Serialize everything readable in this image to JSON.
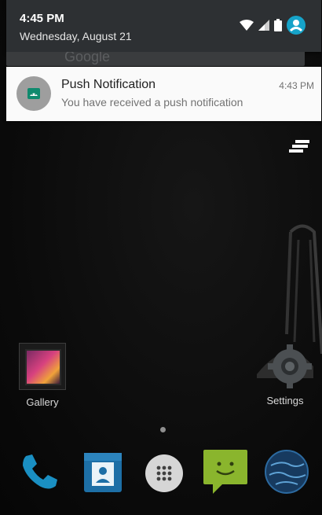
{
  "status": {
    "time": "4:45 PM",
    "date": "Wednesday, August 21",
    "icons": [
      "wifi-icon",
      "signal-icon",
      "battery-icon",
      "user-avatar-icon"
    ],
    "accent": "#16a3c9"
  },
  "search_peek": {
    "text": "Google"
  },
  "notification": {
    "title": "Push Notification",
    "text": "You have received a push notification",
    "time": "4:43 PM",
    "icon": "android-icon"
  },
  "home": {
    "apps": [
      {
        "label": "Gallery",
        "icon": "gallery-icon"
      },
      {
        "label": "Settings",
        "icon": "settings-gear-icon"
      }
    ],
    "dock": [
      "phone-icon",
      "contacts-icon",
      "app-drawer-icon",
      "messaging-icon",
      "browser-globe-icon"
    ]
  }
}
